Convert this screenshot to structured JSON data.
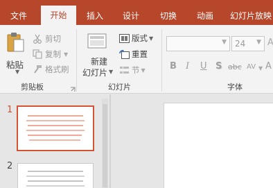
{
  "tabs": [
    {
      "label": "文件",
      "active": false
    },
    {
      "label": "开始",
      "active": true
    },
    {
      "label": "插入",
      "active": false
    },
    {
      "label": "设计",
      "active": false
    },
    {
      "label": "切换",
      "active": false
    },
    {
      "label": "动画",
      "active": false
    },
    {
      "label": "幻灯片放映",
      "active": false
    }
  ],
  "clipboard": {
    "paste_label": "粘贴",
    "cut_label": "剪切",
    "copy_label": "复制",
    "format_painter_label": "格式刷",
    "group_label": "剪贴板",
    "launcher_icon": "dialog-launcher-icon"
  },
  "slides_group": {
    "new_slide_line1": "新建",
    "new_slide_line2": "幻灯片",
    "layout_label": "版式",
    "reset_label": "重置",
    "section_label": "节",
    "group_label": "幻灯片"
  },
  "font_group": {
    "font_name_value": "",
    "font_size_value": "24",
    "group_label": "字体",
    "bold": "B",
    "italic": "I",
    "underline": "U",
    "shadow": "S",
    "strikethrough": "abc",
    "char_spacing": "AV",
    "change_case": "A"
  },
  "slides": [
    {
      "number": "1",
      "selected": true
    },
    {
      "number": "2",
      "selected": false
    }
  ],
  "colors": {
    "accent": "#b7472a",
    "selection": "#d35230",
    "thumb_text_1": "#f0a898",
    "thumb_text_2": "#c4c4c4"
  }
}
